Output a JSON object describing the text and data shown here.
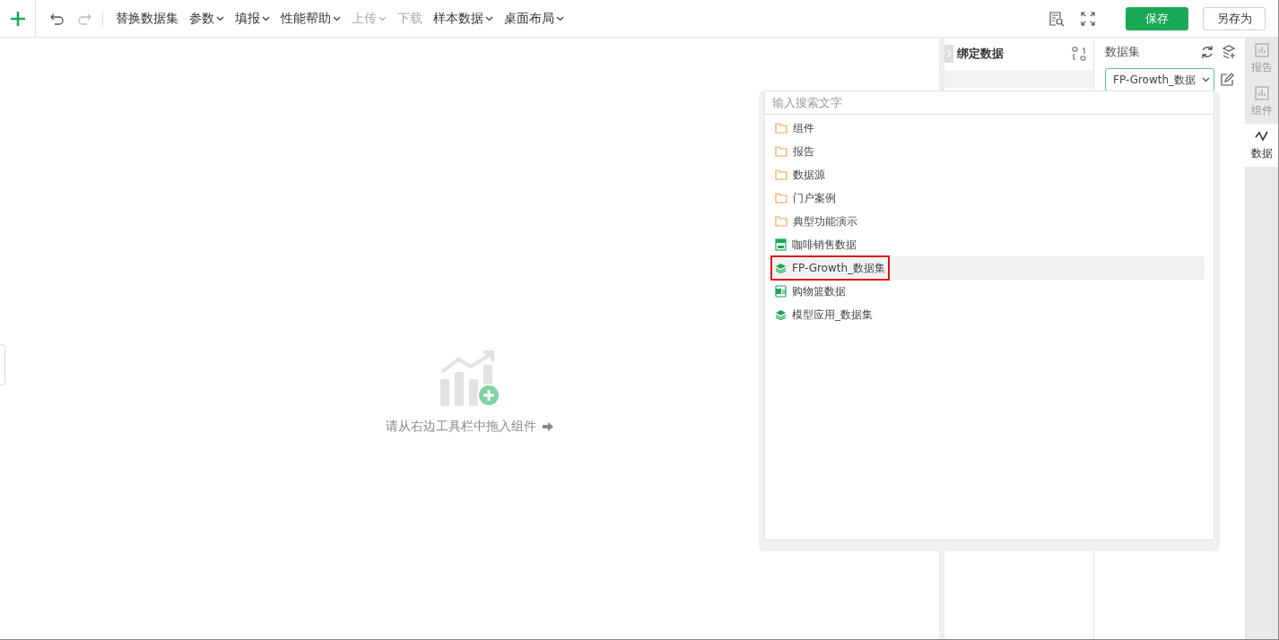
{
  "toolbar": {
    "menus": [
      {
        "label": "替换数据集",
        "caret": false,
        "disabled": false
      },
      {
        "label": "参数",
        "caret": true,
        "disabled": false
      },
      {
        "label": "填报",
        "caret": true,
        "disabled": false
      },
      {
        "label": "性能帮助",
        "caret": true,
        "disabled": false
      },
      {
        "label": "上传",
        "caret": true,
        "disabled": true
      },
      {
        "label": "下载",
        "caret": false,
        "disabled": true
      },
      {
        "label": "样本数据",
        "caret": true,
        "disabled": false
      },
      {
        "label": "桌面布局",
        "caret": true,
        "disabled": false
      }
    ],
    "redo_disabled": true,
    "save": "保存",
    "save_as": "另存为"
  },
  "canvas": {
    "hint": "请从右边工具栏中拖入组件"
  },
  "bind_panel": {
    "title": "绑定数据"
  },
  "dataset_panel": {
    "title": "数据集",
    "select_value": "FP-Growth_数据"
  },
  "rail": [
    {
      "label": "报告",
      "selected": false
    },
    {
      "label": "组件",
      "selected": false
    },
    {
      "label": "数据",
      "selected": true
    }
  ],
  "dropdown": {
    "placeholder": "输入搜索文字",
    "items": [
      {
        "kind": "folder",
        "label": "组件",
        "selected": false
      },
      {
        "kind": "folder",
        "label": "报告",
        "selected": false
      },
      {
        "kind": "folder",
        "label": "数据源",
        "selected": false
      },
      {
        "kind": "folder",
        "label": "门户案例",
        "selected": false
      },
      {
        "kind": "folder",
        "label": "典型功能演示",
        "selected": false
      },
      {
        "kind": "sql",
        "label": "咖啡销售数据",
        "selected": false
      },
      {
        "kind": "dataset",
        "label": "FP-Growth_数据集",
        "selected": true
      },
      {
        "kind": "excel",
        "label": "购物篮数据",
        "selected": false
      },
      {
        "kind": "dataset",
        "label": "模型应用_数据集",
        "selected": false
      }
    ]
  }
}
